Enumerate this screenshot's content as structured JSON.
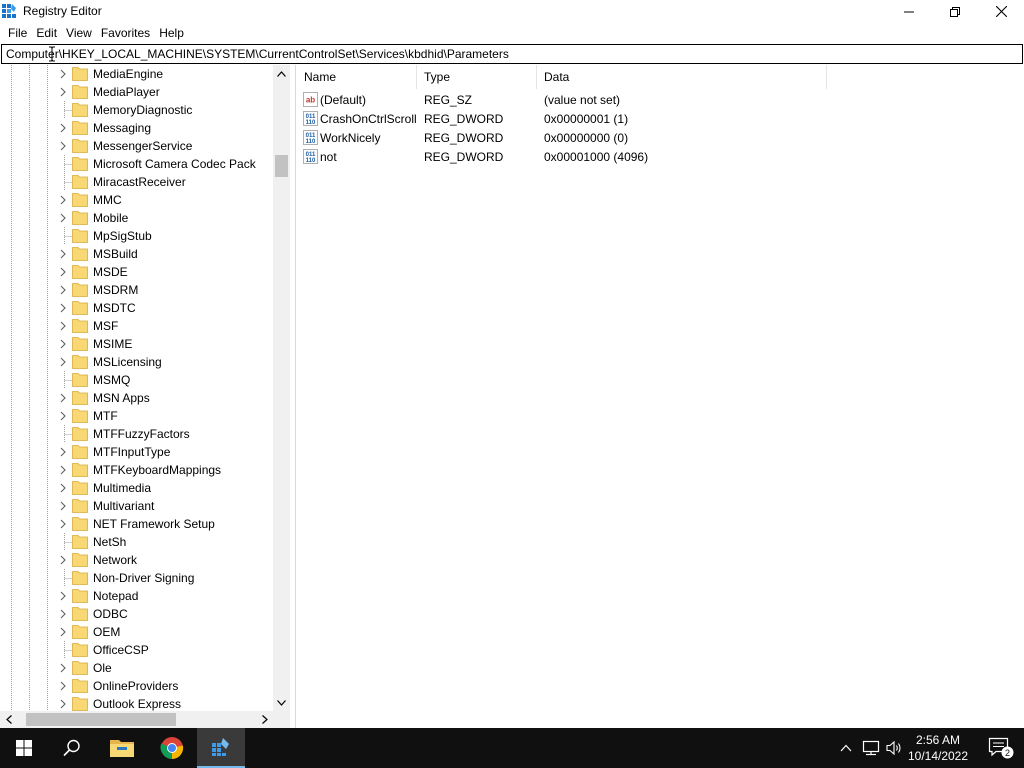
{
  "window": {
    "title": "Registry Editor",
    "icon": "regedit-icon"
  },
  "menu": [
    "File",
    "Edit",
    "View",
    "Favorites",
    "Help"
  ],
  "address": "Computer\\HKEY_LOCAL_MACHINE\\SYSTEM\\CurrentControlSet\\Services\\kbdhid\\Parameters",
  "tree": [
    {
      "label": "MediaEngine",
      "expandable": true
    },
    {
      "label": "MediaPlayer",
      "expandable": true
    },
    {
      "label": "MemoryDiagnostic",
      "expandable": false
    },
    {
      "label": "Messaging",
      "expandable": true
    },
    {
      "label": "MessengerService",
      "expandable": true
    },
    {
      "label": "Microsoft Camera Codec Pack",
      "expandable": false
    },
    {
      "label": "MiracastReceiver",
      "expandable": false
    },
    {
      "label": "MMC",
      "expandable": true
    },
    {
      "label": "Mobile",
      "expandable": true
    },
    {
      "label": "MpSigStub",
      "expandable": false
    },
    {
      "label": "MSBuild",
      "expandable": true
    },
    {
      "label": "MSDE",
      "expandable": true
    },
    {
      "label": "MSDRM",
      "expandable": true
    },
    {
      "label": "MSDTC",
      "expandable": true
    },
    {
      "label": "MSF",
      "expandable": true
    },
    {
      "label": "MSIME",
      "expandable": true
    },
    {
      "label": "MSLicensing",
      "expandable": true
    },
    {
      "label": "MSMQ",
      "expandable": false
    },
    {
      "label": "MSN Apps",
      "expandable": true
    },
    {
      "label": "MTF",
      "expandable": true
    },
    {
      "label": "MTFFuzzyFactors",
      "expandable": false
    },
    {
      "label": "MTFInputType",
      "expandable": true
    },
    {
      "label": "MTFKeyboardMappings",
      "expandable": true
    },
    {
      "label": "Multimedia",
      "expandable": true
    },
    {
      "label": "Multivariant",
      "expandable": true
    },
    {
      "label": "NET Framework Setup",
      "expandable": true
    },
    {
      "label": "NetSh",
      "expandable": false
    },
    {
      "label": "Network",
      "expandable": true
    },
    {
      "label": "Non-Driver Signing",
      "expandable": false
    },
    {
      "label": "Notepad",
      "expandable": true
    },
    {
      "label": "ODBC",
      "expandable": true
    },
    {
      "label": "OEM",
      "expandable": true
    },
    {
      "label": "OfficeCSP",
      "expandable": false
    },
    {
      "label": "Ole",
      "expandable": true
    },
    {
      "label": "OnlineProviders",
      "expandable": true
    },
    {
      "label": "Outlook Express",
      "expandable": true
    }
  ],
  "columns": {
    "name": "Name",
    "type": "Type",
    "data": "Data"
  },
  "values": [
    {
      "name": "(Default)",
      "type": "REG_SZ",
      "data": "(value not set)",
      "icon": "string-value-icon"
    },
    {
      "name": "CrashOnCtrlScroll",
      "type": "REG_DWORD",
      "data": "0x00000001 (1)",
      "icon": "binary-value-icon"
    },
    {
      "name": "WorkNicely",
      "type": "REG_DWORD",
      "data": "0x00000000 (0)",
      "icon": "binary-value-icon"
    },
    {
      "name": "not",
      "type": "REG_DWORD",
      "data": "0x00001000 (4096)",
      "icon": "binary-value-icon"
    }
  ],
  "taskbar": {
    "apps": [
      "start-icon",
      "search-icon",
      "file-explorer-icon",
      "chrome-icon",
      "regedit-icon"
    ],
    "time": "2:56 AM",
    "date": "10/14/2022",
    "notification_count": "2"
  },
  "colors": {
    "folder": "#f8d775",
    "taskbar": "#101010",
    "accent": "#76b9ed"
  }
}
